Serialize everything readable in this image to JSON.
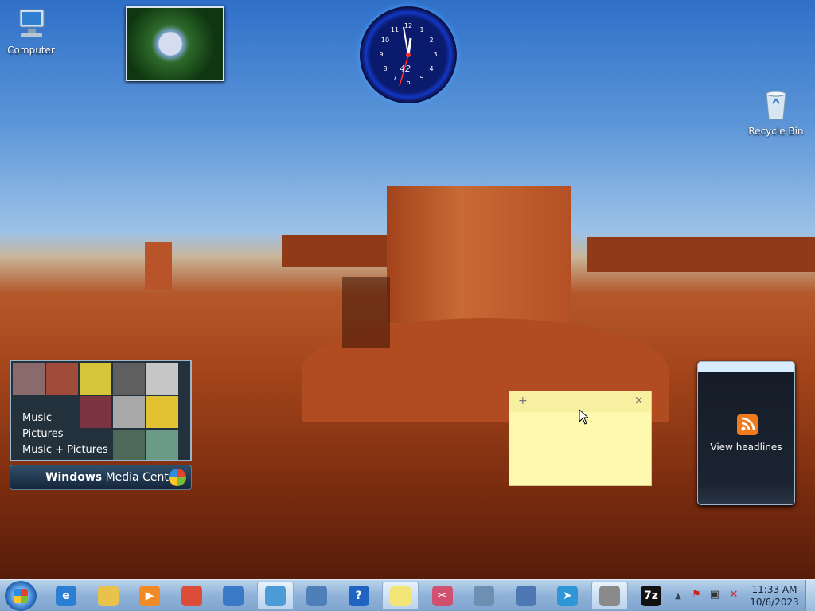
{
  "desktop": {
    "icons": [
      {
        "label": "Computer",
        "icon": "computer-icon"
      },
      {
        "label": "Recycle Bin",
        "icon": "recycle-bin-icon"
      }
    ]
  },
  "gadgets": {
    "clock": {
      "numbers": [
        "12",
        "1",
        "2",
        "3",
        "4",
        "5",
        "6",
        "7",
        "8",
        "9",
        "10",
        "11"
      ],
      "digital": "42"
    },
    "media_center": {
      "menu": [
        "Music",
        "Pictures",
        "Music + Pictures"
      ],
      "brand_bold": "Windows",
      "brand_rest": "Media Center"
    },
    "sticky_note": {
      "add_symbol": "+",
      "close_symbol": "×",
      "text": ""
    },
    "feed": {
      "label": "View headlines",
      "icon": "rss-icon"
    }
  },
  "taskbar": {
    "items": [
      {
        "name": "internet-explorer",
        "icon": "ie-icon",
        "symbol": "e",
        "color": "#2a7fd4"
      },
      {
        "name": "explorer",
        "icon": "folder-icon",
        "symbol": "",
        "color": "#e8c24a"
      },
      {
        "name": "media-player",
        "icon": "media-player-icon",
        "symbol": "▶",
        "color": "#f08a24"
      },
      {
        "name": "chrome",
        "icon": "chrome-icon",
        "symbol": "",
        "color": "#dd4b39"
      },
      {
        "name": "remote-desktop",
        "icon": "remote-desktop-icon",
        "symbol": "",
        "color": "#3a79c6"
      },
      {
        "name": "control-panel",
        "icon": "control-panel-icon",
        "symbol": "",
        "color": "#4d9bd6"
      },
      {
        "name": "network",
        "icon": "network-icon",
        "symbol": "",
        "color": "#4e7fb8"
      },
      {
        "name": "help",
        "icon": "help-icon",
        "symbol": "?",
        "color": "#1f64c0"
      },
      {
        "name": "sticky-notes",
        "icon": "sticky-notes-icon",
        "symbol": "",
        "color": "#f2e576"
      },
      {
        "name": "snipping-tool",
        "icon": "snipping-tool-icon",
        "symbol": "✂",
        "color": "#d05070"
      },
      {
        "name": "calculator",
        "icon": "calculator-icon",
        "symbol": "",
        "color": "#6d8fb2"
      },
      {
        "name": "magnifier",
        "icon": "magnifier-icon",
        "symbol": "",
        "color": "#4d78b4"
      },
      {
        "name": "send",
        "icon": "send-icon",
        "symbol": "➤",
        "color": "#2d96d6"
      },
      {
        "name": "firewall",
        "icon": "firewall-icon",
        "symbol": "",
        "color": "#8a8a8a"
      },
      {
        "name": "7zip",
        "icon": "7zip-icon",
        "symbol": "7z",
        "color": "#111111"
      }
    ],
    "tray": {
      "up_arrow": "▲",
      "icons": [
        {
          "name": "action-center-icon",
          "symbol": "⚑"
        },
        {
          "name": "network-tray-icon",
          "symbol": "▣"
        },
        {
          "name": "volume-muted-icon",
          "symbol": "✕"
        }
      ],
      "time": "11:33 AM",
      "date": "10/6/2023"
    }
  }
}
